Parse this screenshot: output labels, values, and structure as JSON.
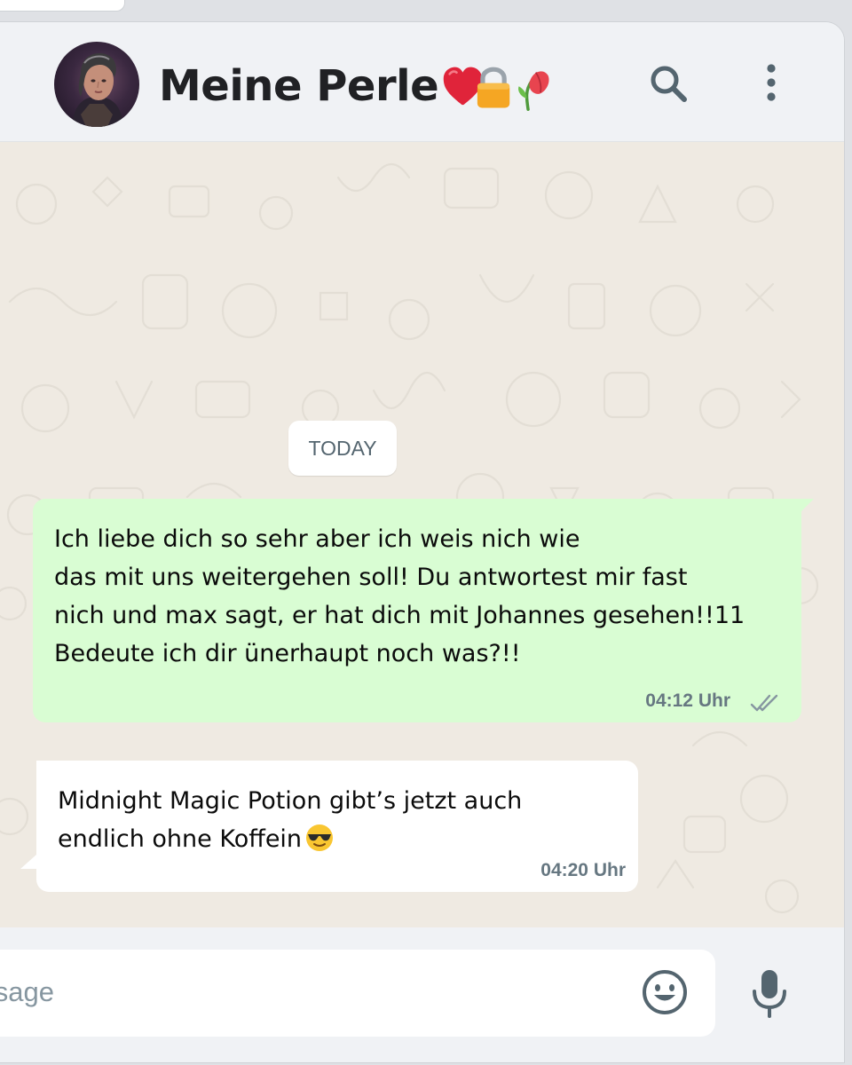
{
  "header": {
    "contact_name": "Meine Perle",
    "name_emojis": [
      "red-heart",
      "locked-padlock",
      "wilted-flower"
    ]
  },
  "chat": {
    "date_label": "TODAY",
    "messages": [
      {
        "direction": "outgoing",
        "lines": [
          "Ich liebe dich so sehr aber ich weis nich wie",
          "das mit uns weitergehen soll! Du antwortest mir fast",
          "nich und max sagt, er hat dich mit Johannes gesehen!!11",
          "Bedeute ich dir ünerhaupt noch was?!!"
        ],
        "time": "04:12 Uhr",
        "status": "delivered"
      },
      {
        "direction": "incoming",
        "lines": [
          "Midnight Magic Potion gibt’s jetzt auch",
          "endlich ohne Koffein"
        ],
        "trailing_emoji": "smiling-face-with-sunglasses",
        "time": "04:20 Uhr"
      }
    ]
  },
  "composer": {
    "placeholder": "essage"
  },
  "colors": {
    "outgoing_bubble": "#d9fdd3",
    "incoming_bubble": "#ffffff",
    "chat_background": "#efeae2",
    "panel": "#f0f2f5",
    "icon": "#54656f"
  }
}
